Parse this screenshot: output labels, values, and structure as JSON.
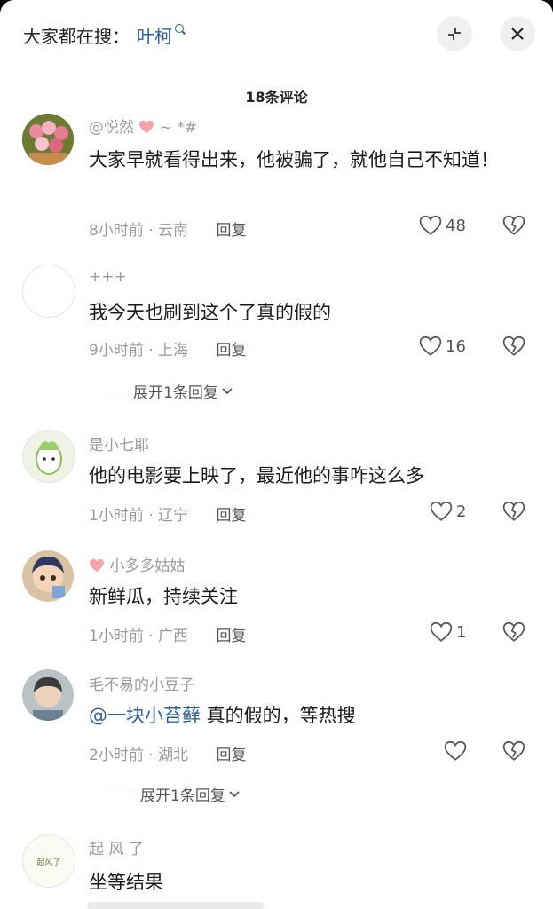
{
  "search": {
    "prefix": "大家都在搜：",
    "term": "叶柯"
  },
  "header": {
    "count_title": "18条评论"
  },
  "comments": [
    {
      "user": "@悦然",
      "user_suffix": "~ *#",
      "text": "大家早就看得出来，他被骗了，就他自己不知道！",
      "time": "8小时前",
      "location": "云南",
      "reply_label": "回复",
      "likes": "48"
    },
    {
      "user": "+++",
      "text": "我今天也刷到这个了真的假的",
      "time": "9小时前",
      "location": "上海",
      "reply_label": "回复",
      "likes": "16",
      "expand_label": "展开1条回复"
    },
    {
      "user": "是小七耶",
      "text": "他的电影要上映了，最近他的事咋这么多",
      "time": "1小时前",
      "location": "辽宁",
      "reply_label": "回复",
      "likes": "2"
    },
    {
      "user": "小多多姑姑",
      "text": "新鲜瓜，持续关注",
      "time": "1小时前",
      "location": "广西",
      "reply_label": "回复",
      "likes": "1"
    },
    {
      "user": "毛不易的小豆子",
      "mention": "@一块小苔藓",
      "text": " 真的假的，等热搜",
      "time": "2小时前",
      "location": "湖北",
      "reply_label": "回复",
      "likes": "",
      "expand_label": "展开1条回复"
    },
    {
      "user": "起 风 了",
      "avatar_text": "起风了",
      "text": "坐等结果"
    }
  ],
  "colors": {
    "link": "#2d5f9a",
    "muted": "#9a9a9a",
    "heart_pink": "#f4a3a8"
  }
}
